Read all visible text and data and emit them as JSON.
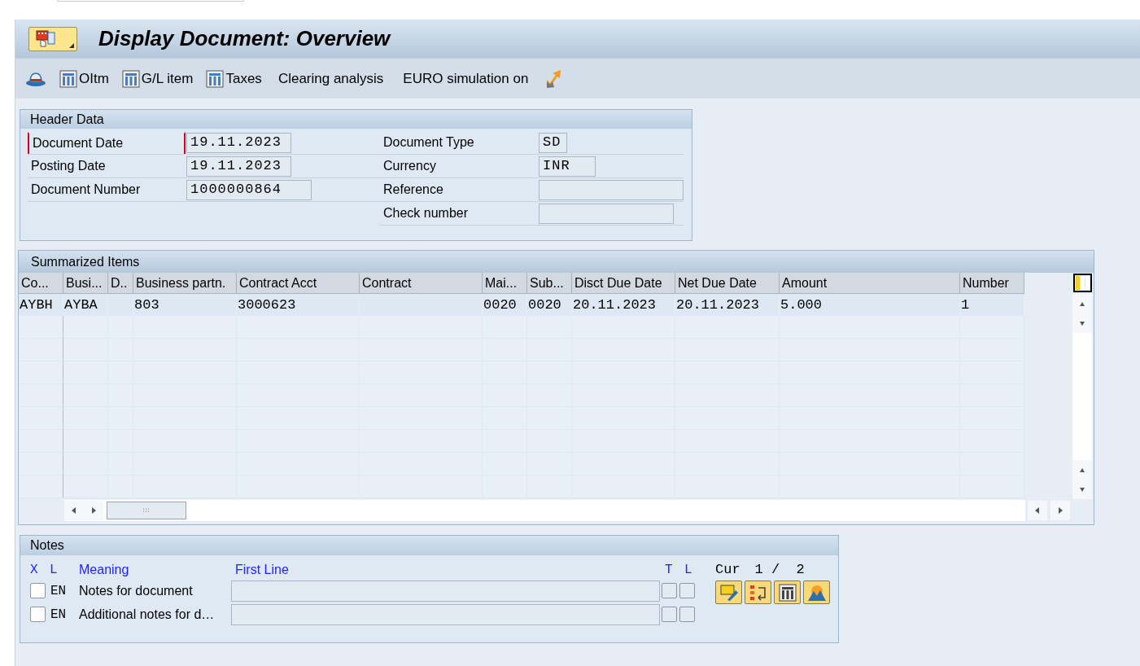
{
  "title": "Display Document: Overview",
  "toolbar": [
    {
      "kind": "hat"
    },
    {
      "kind": "table",
      "label": "OItm"
    },
    {
      "kind": "table",
      "label": "G/L item"
    },
    {
      "kind": "table",
      "label": "Taxes"
    },
    {
      "kind": "text",
      "label": "Clearing analysis"
    },
    {
      "kind": "text",
      "label": "EURO simulation on"
    },
    {
      "kind": "arrow"
    }
  ],
  "header_data": {
    "title": "Header Data",
    "left": [
      {
        "label": "Document Date",
        "value": "19.11.2023",
        "focused": true
      },
      {
        "label": "Posting Date",
        "value": "19.11.2023",
        "focused": false
      },
      {
        "label": "Document Number",
        "value": "1000000864",
        "focused": false
      }
    ],
    "right": [
      {
        "label": "Document Type",
        "value": "SD",
        "focused": false
      },
      {
        "label": "Currency",
        "value": "INR",
        "focused": false
      },
      {
        "label": "Reference",
        "focused": false
      },
      {
        "label": "Check number",
        "focused": false
      }
    ]
  },
  "summarized_items": {
    "title": "Summarized Items",
    "columns": [
      "Co...",
      "Busi...",
      "D..",
      "Business partn.",
      "Contract Acct",
      "Contract",
      "Mai...",
      "Sub...",
      "Disct Due Date",
      "Net Due Date",
      "Amount",
      "Number"
    ],
    "rows": [
      [
        "AYBH",
        "AYBA",
        null,
        "803",
        "3000623",
        null,
        "0020",
        "0020",
        "20.11.2023",
        "20.11.2023",
        "5.000",
        "1"
      ]
    ]
  },
  "notes": {
    "title": "Notes",
    "headers": {
      "x": "X",
      "l": "L",
      "meaning": "Meaning",
      "first_line": "First Line",
      "t": "T",
      "l2": "L"
    },
    "cursor_label": "Cur",
    "page": "1 /  2",
    "rows": [
      {
        "checked": false,
        "lang": "EN",
        "meaning": "Notes for document"
      },
      {
        "checked": false,
        "lang": "EN",
        "meaning": "Additional notes for d…"
      }
    ]
  }
}
